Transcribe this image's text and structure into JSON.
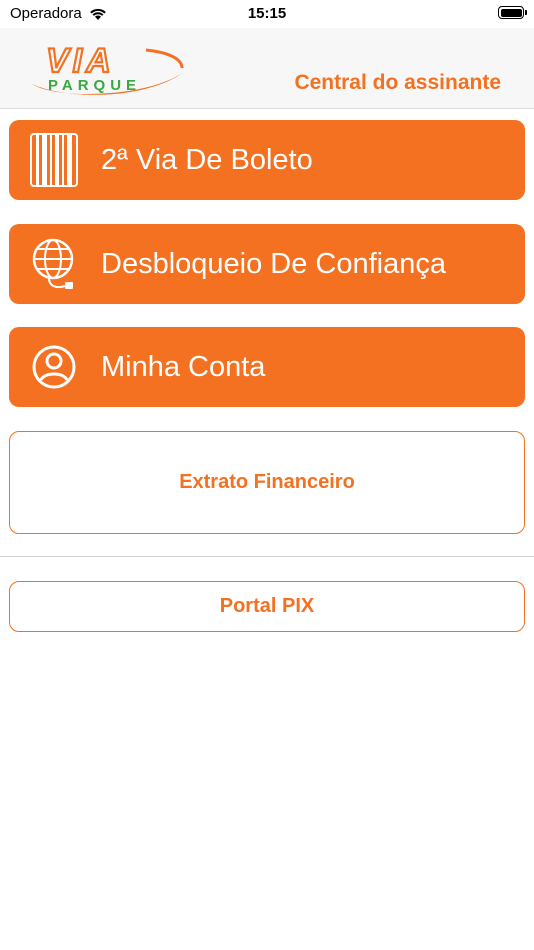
{
  "status_bar": {
    "carrier": "Operadora",
    "time": "15:15"
  },
  "header": {
    "logo": {
      "text_top": "VIA",
      "text_bottom": "PARQUE"
    },
    "title": "Central do assinante"
  },
  "menu": {
    "items": [
      {
        "label": "2ª Via De Boleto",
        "icon": "barcode-icon"
      },
      {
        "label": "Desbloqueio De Confiança",
        "icon": "globe-icon"
      },
      {
        "label": "Minha Conta",
        "icon": "user-icon"
      }
    ]
  },
  "buttons": {
    "extrato": "Extrato Financeiro",
    "pix": "Portal PIX"
  },
  "colors": {
    "accent": "#f37121",
    "logo_green": "#3aa845",
    "header_bg": "#f7f7f7"
  }
}
